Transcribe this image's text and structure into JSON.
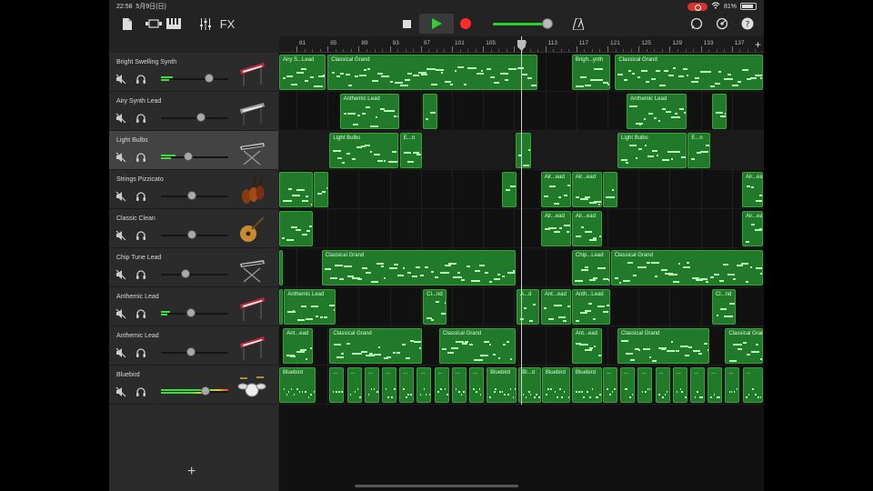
{
  "status_bar": {
    "time": "22:58",
    "date": "5月9日(日)",
    "battery": "81%"
  },
  "toolbar": {
    "fx_label": "FX"
  },
  "ruler": {
    "numbers": [
      "81",
      "85",
      "89",
      "93",
      "97",
      "101",
      "105",
      "109",
      "113",
      "117",
      "121",
      "125",
      "129",
      "133",
      "137"
    ]
  },
  "tracks": [
    {
      "name": "Bright Swelling Synth",
      "instrument": "keyboard-red-icon",
      "volume": 0.72,
      "meter": 0.18
    },
    {
      "name": "Airy Synth Lead",
      "instrument": "keyboard-silver-icon",
      "volume": 0.6,
      "meter": 0
    },
    {
      "name": "Light Bulbs",
      "instrument": "keyboard-stand-icon",
      "volume": 0.4,
      "meter": 0.22
    },
    {
      "name": "Strings Pizzicato",
      "instrument": "violins-icon",
      "volume": 0.46,
      "meter": 0
    },
    {
      "name": "Classic Clean",
      "instrument": "guitar-icon",
      "volume": 0.46,
      "meter": 0
    },
    {
      "name": "Chip Tune Lead",
      "instrument": "keyboard-stand-icon",
      "volume": 0.36,
      "meter": 0
    },
    {
      "name": "Anthemic Lead",
      "instrument": "keyboard-red-icon",
      "volume": 0.44,
      "meter": 0.14
    },
    {
      "name": "Anthemic Lead",
      "instrument": "keyboard-red-icon",
      "volume": 0.44,
      "meter": 0
    },
    {
      "name": "Bluebird",
      "instrument": "drumkit-icon",
      "volume": 0.66,
      "meter": 1.0
    }
  ],
  "regions": [
    {
      "track": 0,
      "start": 0.0,
      "width": 0.098,
      "label": "Airy S...Lead"
    },
    {
      "track": 0,
      "start": 0.1,
      "width": 0.435,
      "label": "Classical Grand"
    },
    {
      "track": 0,
      "start": 0.604,
      "width": 0.08,
      "label": "Brigh...ynth"
    },
    {
      "track": 0,
      "start": 0.693,
      "width": 0.307,
      "label": "Classical Grand"
    },
    {
      "track": 1,
      "start": 0.125,
      "width": 0.124,
      "label": "Anthemic Lead"
    },
    {
      "track": 1,
      "start": 0.297,
      "width": 0.032,
      "label": ""
    },
    {
      "track": 1,
      "start": 0.717,
      "width": 0.125,
      "label": "Anthemic Lead"
    },
    {
      "track": 1,
      "start": 0.893,
      "width": 0.032,
      "label": ""
    },
    {
      "track": 2,
      "start": 0.104,
      "width": 0.144,
      "label": "Light Bulbs"
    },
    {
      "track": 2,
      "start": 0.249,
      "width": 0.048,
      "label": "E...n"
    },
    {
      "track": 2,
      "start": 0.488,
      "width": 0.033,
      "label": ""
    },
    {
      "track": 2,
      "start": 0.698,
      "width": 0.144,
      "label": "Light Bulbs"
    },
    {
      "track": 2,
      "start": 0.843,
      "width": 0.048,
      "label": "E...n"
    },
    {
      "track": 3,
      "start": 0.0,
      "width": 0.072,
      "label": ""
    },
    {
      "track": 3,
      "start": 0.072,
      "width": 0.032,
      "label": ""
    },
    {
      "track": 3,
      "start": 0.46,
      "width": 0.032,
      "label": ""
    },
    {
      "track": 3,
      "start": 0.54,
      "width": 0.064,
      "label": "Air...ead"
    },
    {
      "track": 3,
      "start": 0.604,
      "width": 0.064,
      "label": "Air...ead"
    },
    {
      "track": 3,
      "start": 0.668,
      "width": 0.032,
      "label": ""
    },
    {
      "track": 3,
      "start": 0.955,
      "width": 0.045,
      "label": "Air...ead"
    },
    {
      "track": 4,
      "start": 0.0,
      "width": 0.072,
      "label": ""
    },
    {
      "track": 4,
      "start": 0.54,
      "width": 0.064,
      "label": "Air...ead"
    },
    {
      "track": 4,
      "start": 0.604,
      "width": 0.064,
      "label": "Air...ead"
    },
    {
      "track": 4,
      "start": 0.955,
      "width": 0.045,
      "label": "Air...ead"
    },
    {
      "track": 5,
      "start": 0.0,
      "width": 0.008,
      "label": ""
    },
    {
      "track": 5,
      "start": 0.088,
      "width": 0.401,
      "label": "Classical Grand"
    },
    {
      "track": 5,
      "start": 0.604,
      "width": 0.08,
      "label": "Chip...Lead"
    },
    {
      "track": 5,
      "start": 0.684,
      "width": 0.316,
      "label": "Classical Grand"
    },
    {
      "track": 6,
      "start": 0.0,
      "width": 0.008,
      "label": ""
    },
    {
      "track": 6,
      "start": 0.01,
      "width": 0.108,
      "label": "Anthemic Lead"
    },
    {
      "track": 6,
      "start": 0.297,
      "width": 0.05,
      "label": "Cl...nd"
    },
    {
      "track": 6,
      "start": 0.49,
      "width": 0.048,
      "label": "A...d"
    },
    {
      "track": 6,
      "start": 0.54,
      "width": 0.064,
      "label": "Ant...ead"
    },
    {
      "track": 6,
      "start": 0.604,
      "width": 0.08,
      "label": "Anth...Lead"
    },
    {
      "track": 6,
      "start": 0.893,
      "width": 0.05,
      "label": "Cl...nd"
    },
    {
      "track": 7,
      "start": 0.008,
      "width": 0.064,
      "label": "Ant...ead"
    },
    {
      "track": 7,
      "start": 0.104,
      "width": 0.192,
      "label": "Classical Grand"
    },
    {
      "track": 7,
      "start": 0.33,
      "width": 0.16,
      "label": "Classical Grand"
    },
    {
      "track": 7,
      "start": 0.604,
      "width": 0.064,
      "label": "Ant...ead"
    },
    {
      "track": 7,
      "start": 0.698,
      "width": 0.192,
      "label": "Classical Grand"
    },
    {
      "track": 7,
      "start": 0.92,
      "width": 0.08,
      "label": "Classical Grand"
    },
    {
      "track": 8,
      "start": 0.0,
      "width": 0.076,
      "label": "Bluebird"
    },
    {
      "track": 8,
      "start": 0.104,
      "width": 0.032,
      "label": "..."
    },
    {
      "track": 8,
      "start": 0.14,
      "width": 0.032,
      "label": "..."
    },
    {
      "track": 8,
      "start": 0.176,
      "width": 0.032,
      "label": "..."
    },
    {
      "track": 8,
      "start": 0.212,
      "width": 0.032,
      "label": "..."
    },
    {
      "track": 8,
      "start": 0.248,
      "width": 0.032,
      "label": "..."
    },
    {
      "track": 8,
      "start": 0.284,
      "width": 0.032,
      "label": "..."
    },
    {
      "track": 8,
      "start": 0.32,
      "width": 0.032,
      "label": "..."
    },
    {
      "track": 8,
      "start": 0.356,
      "width": 0.032,
      "label": "..."
    },
    {
      "track": 8,
      "start": 0.392,
      "width": 0.032,
      "label": "..."
    },
    {
      "track": 8,
      "start": 0.428,
      "width": 0.064,
      "label": "Bluebird"
    },
    {
      "track": 8,
      "start": 0.494,
      "width": 0.048,
      "label": "Bl...d"
    },
    {
      "track": 8,
      "start": 0.542,
      "width": 0.06,
      "label": "Bluebird"
    },
    {
      "track": 8,
      "start": 0.604,
      "width": 0.064,
      "label": "Bluebird"
    },
    {
      "track": 8,
      "start": 0.668,
      "width": 0.032,
      "label": "..."
    },
    {
      "track": 8,
      "start": 0.704,
      "width": 0.032,
      "label": "..."
    },
    {
      "track": 8,
      "start": 0.74,
      "width": 0.032,
      "label": "..."
    },
    {
      "track": 8,
      "start": 0.776,
      "width": 0.032,
      "label": "..."
    },
    {
      "track": 8,
      "start": 0.812,
      "width": 0.032,
      "label": "..."
    },
    {
      "track": 8,
      "start": 0.848,
      "width": 0.032,
      "label": "..."
    },
    {
      "track": 8,
      "start": 0.884,
      "width": 0.032,
      "label": "..."
    },
    {
      "track": 8,
      "start": 0.92,
      "width": 0.032,
      "label": "..."
    },
    {
      "track": 8,
      "start": 0.956,
      "width": 0.044,
      "label": "..."
    }
  ],
  "playhead_position": 0.499
}
